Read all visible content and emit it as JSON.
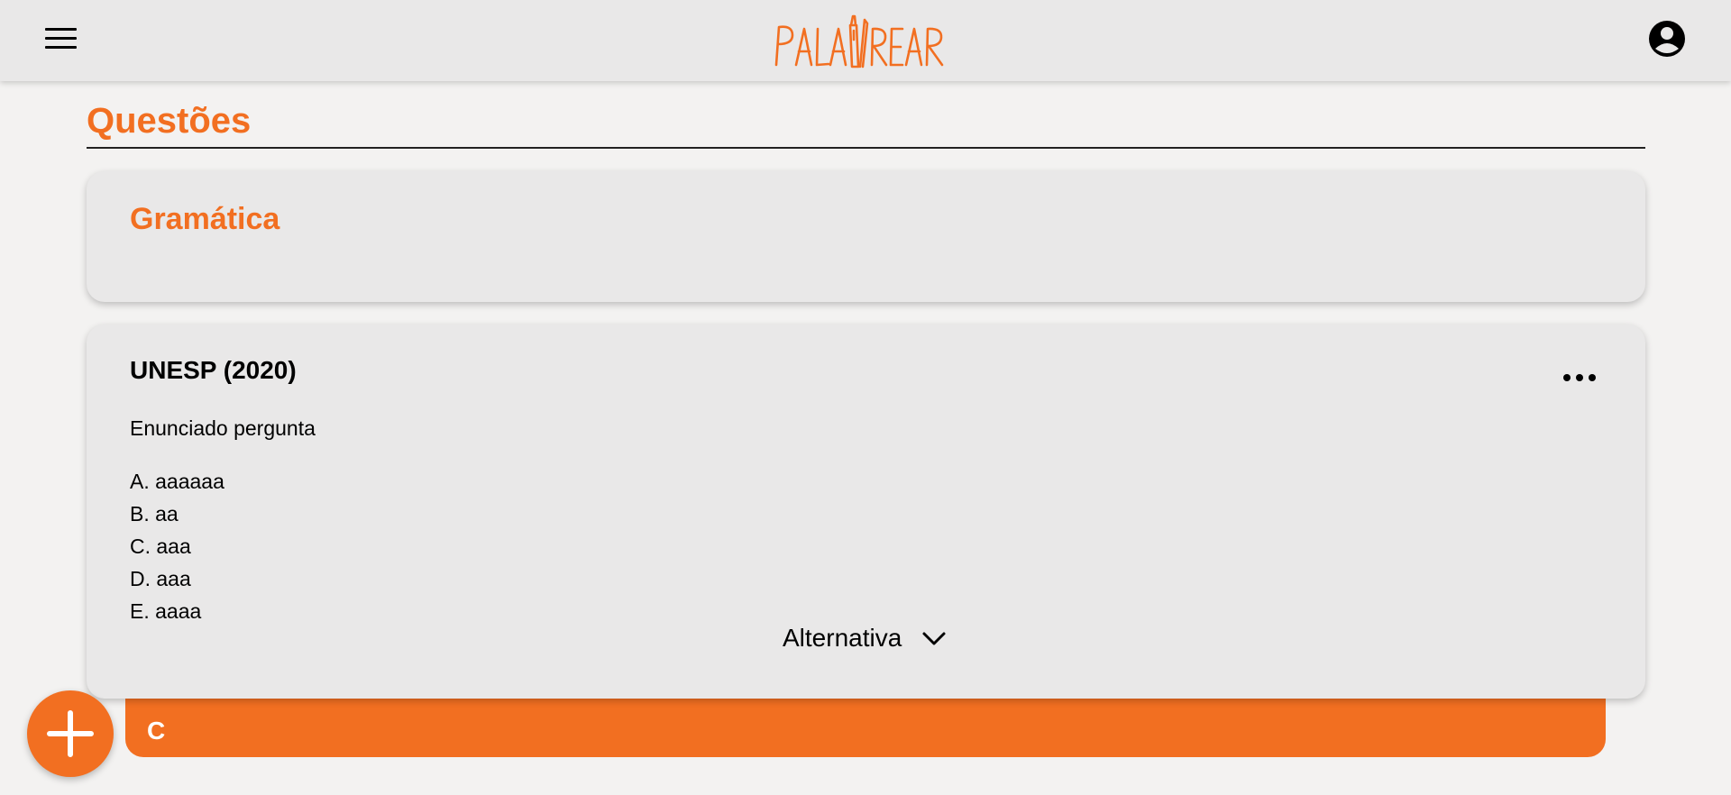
{
  "header": {
    "menu_icon": "hamburger-menu-icon",
    "logo_text": "PALAVREAR",
    "account_icon": "account-circle-icon"
  },
  "page": {
    "title": "Questões"
  },
  "category": {
    "title": "Gramática"
  },
  "question": {
    "source": "UNESP (2020)",
    "more_icon": "more-horizontal-icon",
    "statement": "Enunciado pergunta",
    "options": [
      "A. aaaaaa",
      "B. aa",
      "C. aaa",
      "D. aaa",
      "E. aaaa"
    ],
    "toggle_label": "Alternativa",
    "toggle_icon": "chevron-down-icon",
    "answer": "C"
  },
  "fab": {
    "icon": "plus-icon"
  },
  "colors": {
    "accent": "#f26f21",
    "appbar_bg": "#e9e8e8",
    "page_bg": "#f3f2f1",
    "card_bg": "#e9e8e8"
  }
}
